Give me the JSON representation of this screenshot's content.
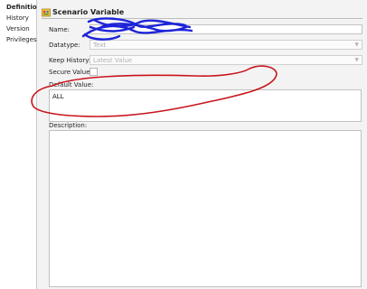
{
  "sidebar": {
    "items": [
      {
        "label": "Definition",
        "active": true
      },
      {
        "label": "History"
      },
      {
        "label": "Version"
      },
      {
        "label": "Privileges"
      }
    ]
  },
  "panel": {
    "title": "Scenario Variable",
    "title_icon": "scenario-variable-icon"
  },
  "form": {
    "name_label": "Name:",
    "name_value": "",
    "datatype_label": "Datatype:",
    "datatype_value": "Text",
    "keep_history_label": "Keep History:",
    "keep_history_value": "Latest Value",
    "secure_label": "Secure Value:",
    "secure_checked": false,
    "default_label": "Default Value:",
    "default_value": "ALL",
    "description_label": "Description:",
    "description_value": ""
  },
  "colors": {
    "annotation_red": "#c8151b",
    "annotation_blue": "#1d24d8"
  }
}
